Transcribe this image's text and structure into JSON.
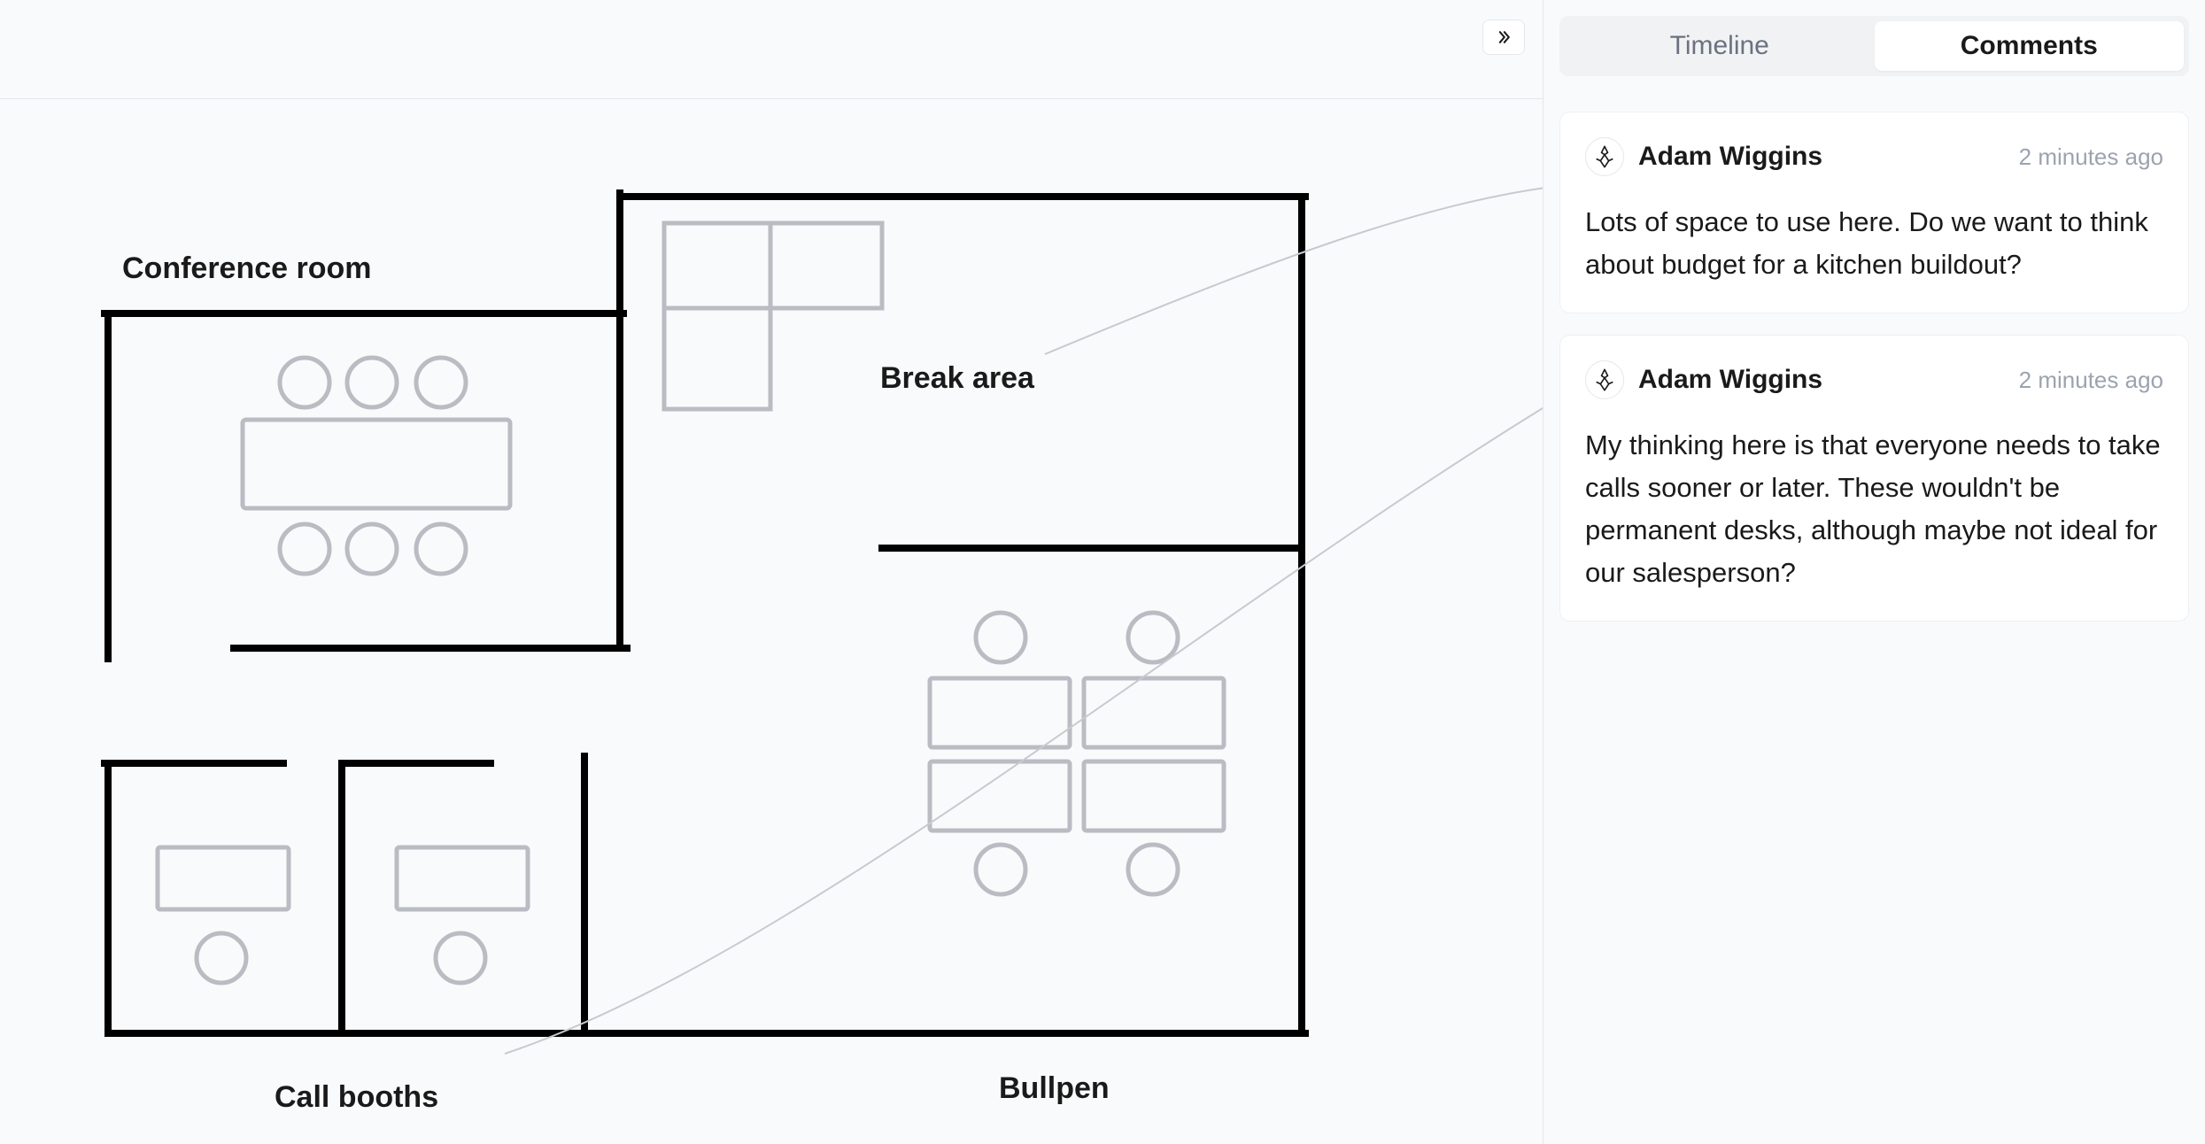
{
  "tabs": {
    "timeline": "Timeline",
    "comments": "Comments"
  },
  "floorplan": {
    "labels": {
      "conference_room": "Conference room",
      "break_area": "Break area",
      "call_booths": "Call booths",
      "bullpen": "Bullpen"
    }
  },
  "comments": [
    {
      "author": "Adam Wiggins",
      "time": "2 minutes ago",
      "body": "Lots of space to use here. Do we want to think about budget for a kitchen buildout?"
    },
    {
      "author": "Adam Wiggins",
      "time": "2 minutes ago",
      "body": "My thinking here is that everyone needs to take calls sooner or later. These wouldn't be permanent desks, although maybe not ideal for our salesperson?"
    }
  ]
}
